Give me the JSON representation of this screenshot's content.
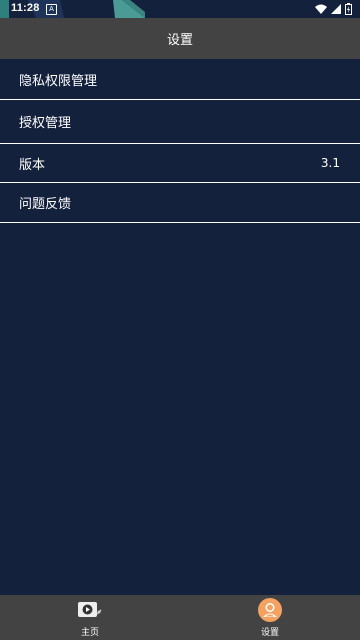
{
  "status_bar": {
    "time": "11:28",
    "notif_glyph": "A",
    "icons": [
      "wifi-icon",
      "signal-icon",
      "battery-icon"
    ]
  },
  "header": {
    "title": "设置"
  },
  "settings": {
    "items": [
      {
        "label": "隐私权限管理",
        "value": ""
      },
      {
        "label": "授权管理",
        "value": ""
      },
      {
        "label": "版本",
        "value": "3.1"
      },
      {
        "label": "问题反馈",
        "value": ""
      }
    ]
  },
  "bottom_nav": {
    "items": [
      {
        "label": "主页",
        "icon": "video-play-icon"
      },
      {
        "label": "设置",
        "icon": "avatar-icon",
        "active": true
      }
    ]
  },
  "colors": {
    "background": "#14213d",
    "bar": "#434343",
    "accent": "#f4a261",
    "divider": "#ffffff"
  }
}
